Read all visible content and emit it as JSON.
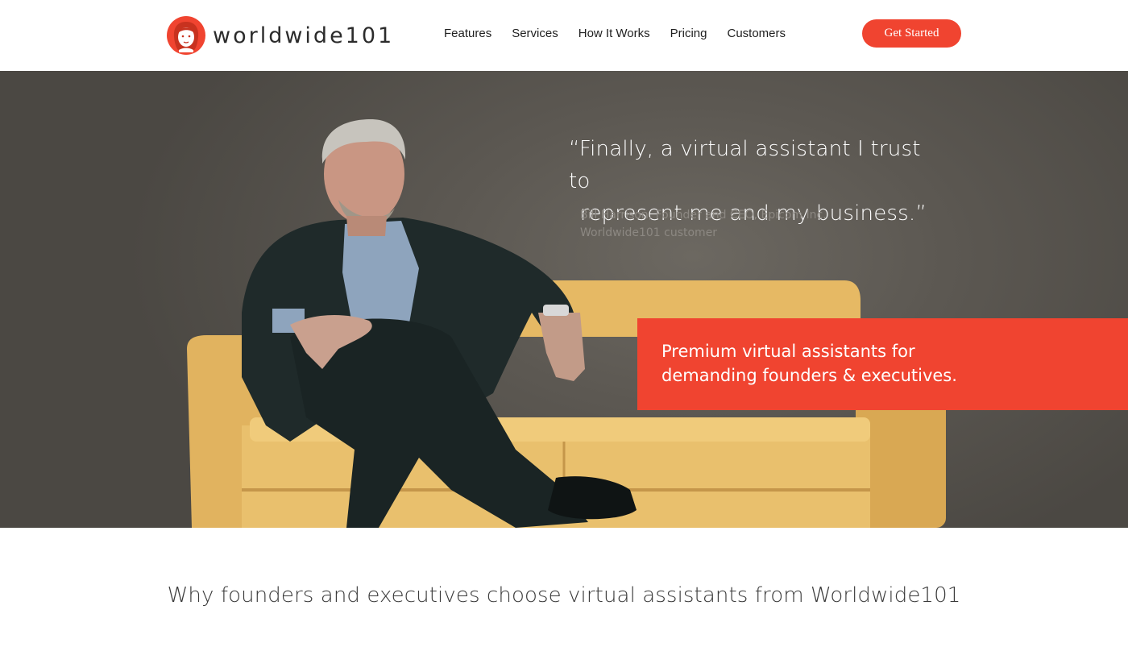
{
  "brand": {
    "name": "worldwide101",
    "logo_icon": "woman-face-logo-icon",
    "accent_color": "#f04430"
  },
  "nav": {
    "items": [
      {
        "label": "Features"
      },
      {
        "label": "Services"
      },
      {
        "label": "How It Works"
      },
      {
        "label": "Pricing"
      },
      {
        "label": "Customers"
      }
    ],
    "cta_label": "Get Started"
  },
  "hero": {
    "quote_line1": "“Finally, a virtual assistant I trust to",
    "quote_line2": "represent me and my business.”",
    "attribution_line1": "Bill Harrison, Founder and CEO, Epicom Inc.",
    "attribution_line2": "Worldwide101 customer",
    "promo_line1": "Premium virtual assistants for",
    "promo_line2": "demanding founders & executives."
  },
  "section": {
    "heading": "Why founders and executives choose virtual assistants from Worldwide101"
  }
}
